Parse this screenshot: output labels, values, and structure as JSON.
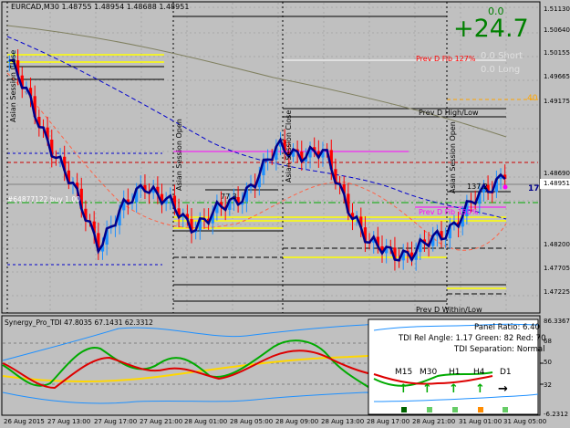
{
  "header": {
    "symbol_line": "EURCAD,M30  1.48755 1.48954 1.48688 1.48951"
  },
  "profit_panel": {
    "small_value": "0.0",
    "big_value": "+24.7",
    "short_label": "0.0  Short",
    "long_label": "0.0  Long"
  },
  "session_labels": [
    "Asian Session Close",
    "Asian Session Open",
    "Asian Session Close",
    "Asian Session Open"
  ],
  "line_labels": {
    "prev_fib_127": "Prev D Fib 127%",
    "prev_high_low": "Prev D High/Low",
    "prev_fib_150": "Prev D Fib 150%",
    "prev_within_low": "Prev D Within/Low",
    "buy_order": "#64877122 buy 1.00",
    "range_1": "77.3",
    "range_2": "137.2",
    "right_marker": "17",
    "top_right_marker": "40"
  },
  "price_axis": {
    "labels": [
      "1.51130",
      "1.50640",
      "1.50155",
      "1.49665",
      "1.49175",
      "1.48951",
      "1.48690",
      "1.48200",
      "1.47705",
      "1.47225"
    ]
  },
  "indicator": {
    "title": "Synergy_Pro_TDI 47.8035 67.1431 62.3312",
    "axis_labels": [
      "86.3367",
      "68",
      "50",
      "32",
      "-6.2312"
    ],
    "info": {
      "panel_ratio": "Panel Ratio: 6.40",
      "rel_angle": "TDI Rel Angle: 1.17 Green: 82 Red: 70",
      "separation": "TDI Separation: Normal",
      "timeframes": [
        "M15",
        "M30",
        "H1",
        "H4",
        "D1"
      ]
    }
  },
  "time_axis": {
    "labels": [
      "26 Aug 2015",
      "27 Aug 13:00",
      "27 Aug 17:00",
      "27 Aug 21:00",
      "28 Aug 01:00",
      "28 Aug 05:00",
      "28 Aug 09:00",
      "28 Aug 13:00",
      "28 Aug 17:00",
      "28 Aug 21:00",
      "31 Aug 01:00",
      "31 Aug 05:00"
    ]
  },
  "chart_data": {
    "type": "line",
    "symbol": "EURCAD",
    "timeframe": "M30",
    "ylim": [
      1.47,
      1.5125
    ],
    "x": [
      "26 Aug 2015",
      "27 Aug 13:00",
      "27 Aug 17:00",
      "27 Aug 21:00",
      "28 Aug 01:00",
      "28 Aug 05:00",
      "28 Aug 09:00",
      "28 Aug 13:00",
      "28 Aug 17:00",
      "28 Aug 21:00",
      "31 Aug 01:00",
      "31 Aug 05:00"
    ],
    "series": [
      {
        "values": [
          1.5045,
          1.492,
          1.4795,
          1.488,
          1.482,
          1.485,
          1.4925,
          1.4915,
          1.479,
          1.478,
          1.483,
          1.4895
        ]
      }
    ],
    "colors": {
      "up": "#1e90ff",
      "down": "#ff0000",
      "line": "#00008b",
      "bg": "#c0c0c0"
    }
  }
}
